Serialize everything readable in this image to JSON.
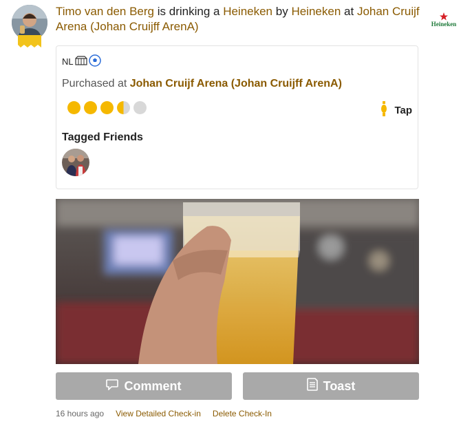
{
  "checkin": {
    "user_name": "Timo van den Berg",
    "text_drinking": "is drinking a",
    "beer_name": "Heineken",
    "text_by": "by",
    "brewery_name": "Heineken",
    "text_at": "at",
    "venue_name": "Johan Cruijf Arena (Johan Cruijff ArenA)",
    "brand_logo_text": "Heineken"
  },
  "details": {
    "flag_text": "NL",
    "purchased_prefix": "Purchased at",
    "purchased_venue": "Johan Cruijf Arena (Johan Cruijff ArenA)",
    "rating": 3.5,
    "rating_max": 5,
    "serving": "Tap",
    "tagged_title": "Tagged Friends"
  },
  "actions": {
    "comment_label": "Comment",
    "toast_label": "Toast"
  },
  "footer": {
    "time": "16 hours ago",
    "view_link": "View Detailed Check-in",
    "delete_link": "Delete Check-In"
  },
  "colors": {
    "link": "#8a5a00",
    "button_bg": "#a9a9a9",
    "rating_on": "#f5b800",
    "rating_off": "#d8d8d8"
  },
  "icons": {
    "serving": "tap-icon",
    "comment": "speech-bubble-icon",
    "toast": "toast-icon"
  }
}
